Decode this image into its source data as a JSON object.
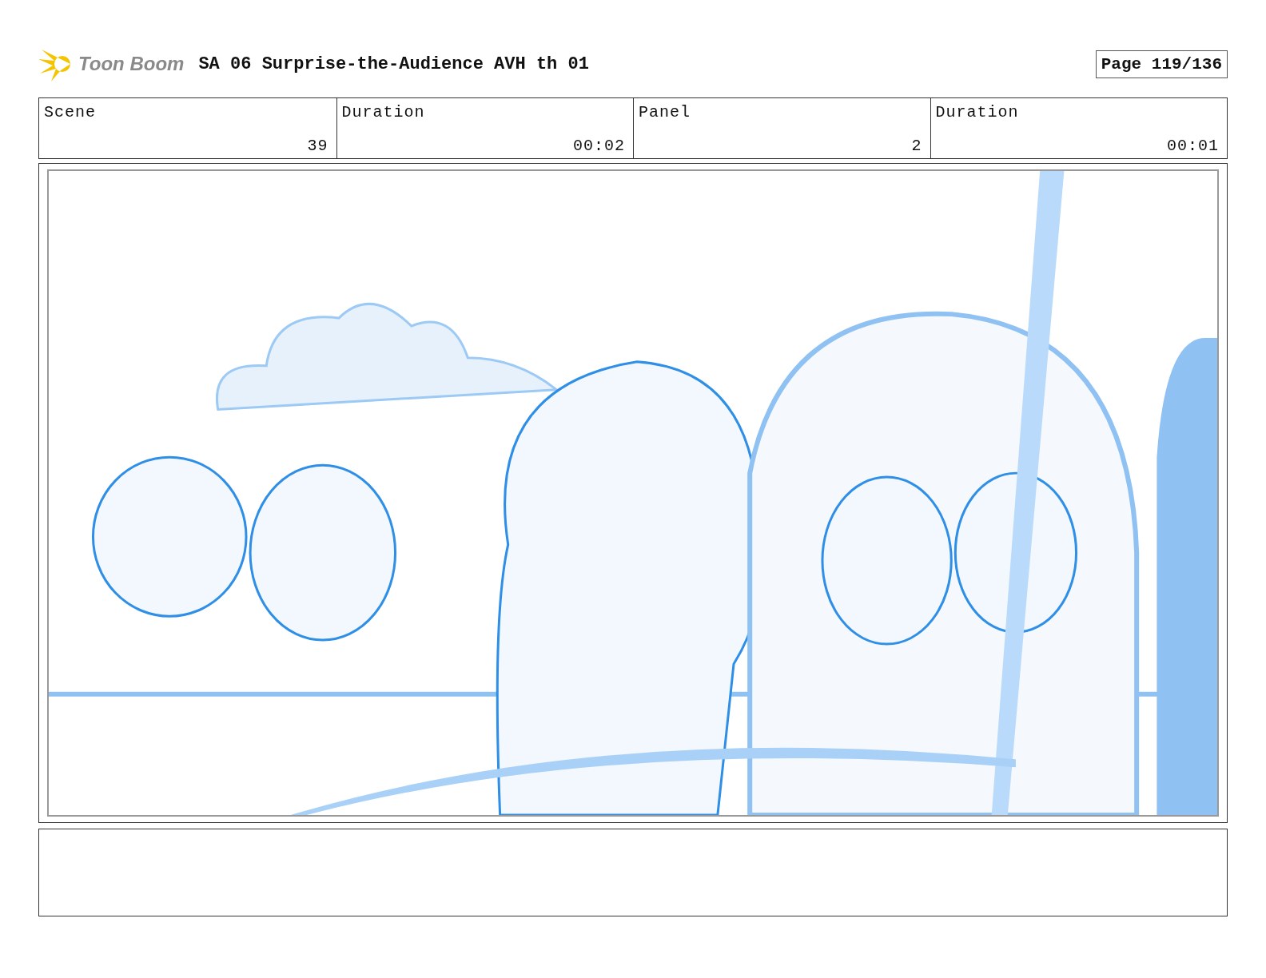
{
  "header": {
    "logo_text": "Toon Boom",
    "title": "SA 06 Surprise-the-Audience AVH th 01",
    "page": "Page 119/136"
  },
  "fields": [
    {
      "label": "Scene",
      "value": "39"
    },
    {
      "label": "Duration",
      "value": "00:02"
    },
    {
      "label": "Panel",
      "value": "2"
    },
    {
      "label": "Duration",
      "value": "00:01"
    }
  ]
}
